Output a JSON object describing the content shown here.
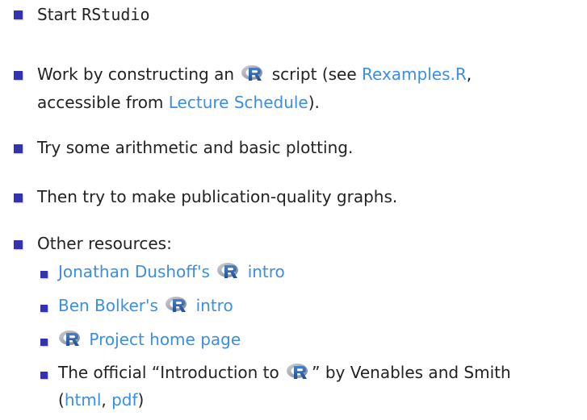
{
  "colors": {
    "bullet": "#3333b2",
    "link": "#3a8ee6",
    "text": "#222222"
  },
  "icons": {
    "bullet": "square-bullet-icon",
    "r_logo": "r-logo-icon"
  },
  "items": {
    "start": {
      "text": "Start ",
      "code": "RStudio"
    },
    "work": {
      "line1_before": "Work by constructing an ",
      "line1_after": " script (see ",
      "link_rexamples": "Rexamples.R",
      "line1_end": ",",
      "line2_before": "accessible from ",
      "link_lecture": "Lecture Schedule",
      "line2_end": ")."
    },
    "arith": "Try some arithmetic and basic plotting.",
    "publication": "Then try to make publication-quality graphs.",
    "other": "Other resources:"
  },
  "resources": {
    "dushoff": {
      "before": "Jonathan Dushoff's ",
      "after": " intro"
    },
    "bolker": {
      "before": "Ben Bolker's ",
      "after": " intro"
    },
    "project": {
      "after": " Project home page"
    },
    "official": {
      "before": "The official “Introduction to ",
      "after": "” by Venables and Smith",
      "line2_open": "(",
      "html": "html",
      "sep": ", ",
      "pdf": "pdf",
      "line2_close": ")"
    }
  }
}
